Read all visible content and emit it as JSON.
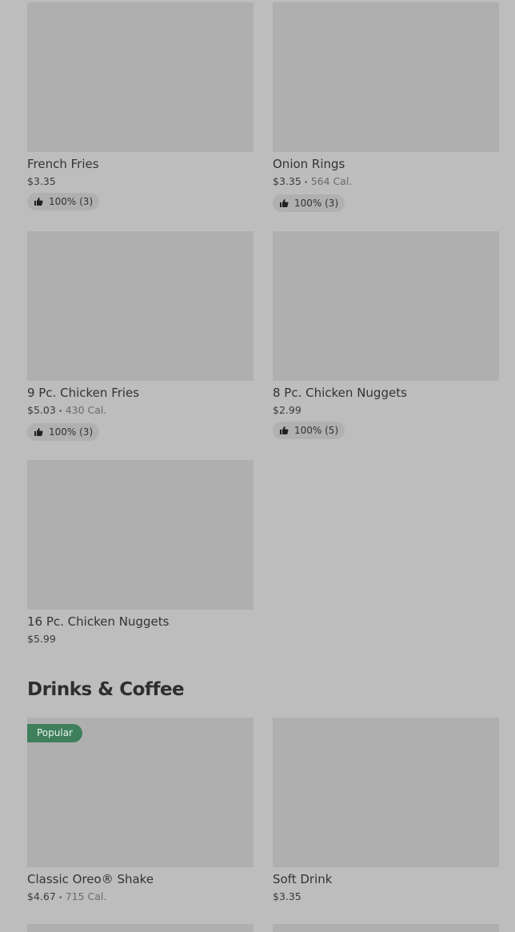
{
  "items": [
    {
      "name": "French Fries",
      "price": "$3.35",
      "calories": "",
      "rating": "100% (3)"
    },
    {
      "name": "Onion Rings",
      "price": "$3.35",
      "calories": "564 Cal.",
      "rating": "100% (3)"
    },
    {
      "name": "9 Pc. Chicken Fries",
      "price": "$5.03",
      "calories": "430 Cal.",
      "rating": "100% (3)"
    },
    {
      "name": "8 Pc. Chicken Nuggets",
      "price": "$2.99",
      "calories": "",
      "rating": "100% (5)"
    },
    {
      "name": "16 Pc. Chicken Nuggets",
      "price": "$5.99",
      "calories": "",
      "rating": ""
    }
  ],
  "drinks_section": {
    "title": "Drinks & Coffee",
    "items": [
      {
        "name": "Classic Oreo® Shake",
        "price": "$4.67",
        "calories": "715 Cal.",
        "badge": "Popular"
      },
      {
        "name": "Soft Drink",
        "price": "$3.35",
        "calories": ""
      }
    ]
  },
  "separator": "•",
  "icons": {
    "rating": "thumbs-up-icon"
  },
  "colors": {
    "background": "#bdbdbd",
    "image_placeholder": "#afafaf",
    "badge": "#3f7f5c"
  }
}
